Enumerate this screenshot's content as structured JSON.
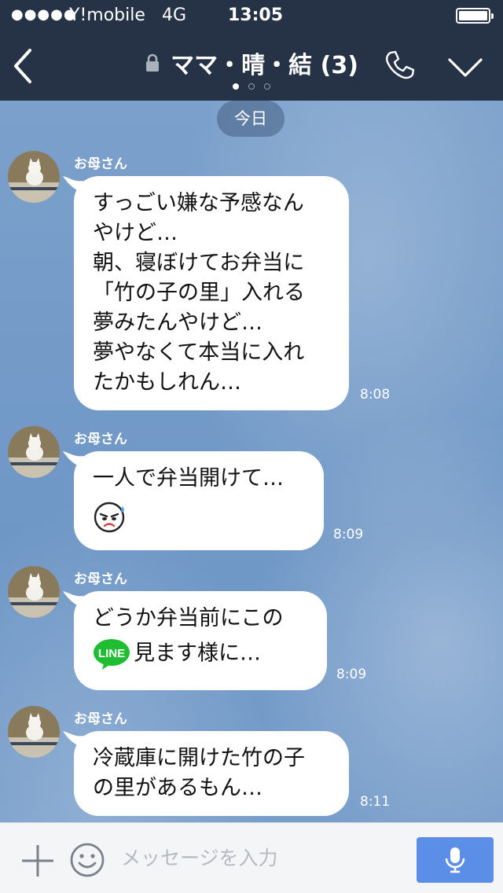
{
  "status_bar": {
    "signal": "●●●●●",
    "carrier": "Y!mobile",
    "network": "4G",
    "time": "13:05",
    "battery_level": 0.95
  },
  "nav": {
    "title": "ママ・晴・結 (3)",
    "back_icon": "chevron-left-icon",
    "lock_icon": "lock-icon",
    "call_icon": "phone-icon",
    "menu_icon": "chevron-down-icon",
    "page_count": 3,
    "active_page": 1
  },
  "chat": {
    "date_label": "今日",
    "messages": [
      {
        "sender": "お母さん",
        "lines": [
          "すっごい嫌な予感なん",
          "やけど…",
          "朝、寝ぼけてお弁当に",
          "「竹の子の里」入れる",
          "夢みたんやけど…",
          "夢やなくて本当に入れ",
          "たかもしれん…"
        ],
        "time": "8:08"
      },
      {
        "sender": "お母さん",
        "lines": [
          "一人で弁当開けて…"
        ],
        "emoji": "sweating-face-icon",
        "time": "8:09"
      },
      {
        "sender": "お母さん",
        "lines": [
          "どうか弁当前にこの"
        ],
        "badge_text": "LINE",
        "line2": "見ます様に…",
        "time": "8:09"
      },
      {
        "sender": "お母さん",
        "lines": [
          "冷蔵庫に開けた竹の子",
          "の里があるもん…"
        ],
        "time": "8:11"
      }
    ]
  },
  "input_bar": {
    "placeholder": "メッセージを入力",
    "plus_icon": "plus-icon",
    "emoji_icon": "smiley-icon",
    "mic_icon": "microphone-icon"
  },
  "colors": {
    "topbar": "#263245",
    "chat_background": "#7ba0cb",
    "bubble": "#ffffff",
    "mic_button": "#5b8ee6",
    "line_green": "#1fbd32"
  }
}
